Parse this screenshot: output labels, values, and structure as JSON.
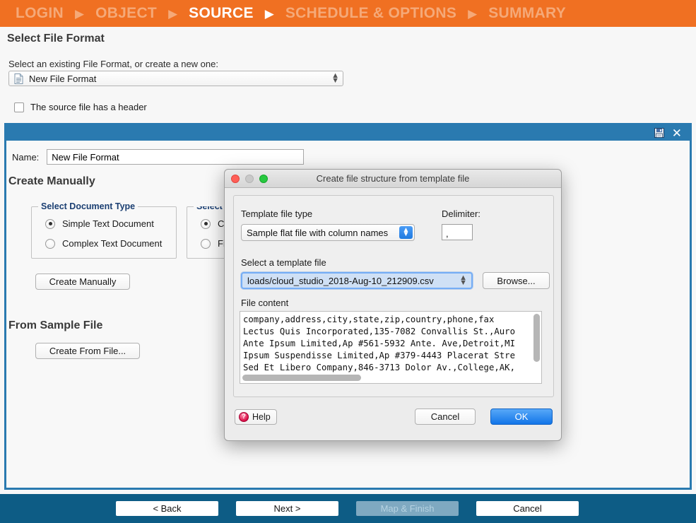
{
  "wizard": {
    "steps": [
      {
        "label": "LOGIN",
        "active": false
      },
      {
        "label": "OBJECT",
        "active": false
      },
      {
        "label": "SOURCE",
        "active": true
      },
      {
        "label": "SCHEDULE & OPTIONS",
        "active": false
      },
      {
        "label": "SUMMARY",
        "active": false
      }
    ],
    "arrow_glyph": "▶",
    "active_color": "#ffffff",
    "inactive_color": "#f5a978",
    "bar_color": "#f07022"
  },
  "page": {
    "title": "Select File Format",
    "format_prompt": "Select an existing File Format, or create a new one:",
    "format_selected": "New File Format",
    "header_checkbox_label": "The source file has a header",
    "header_checkbox_checked": false
  },
  "panel": {
    "titlebar_color": "#2a7ab0",
    "save_icon": "save-floppy-icon",
    "close_icon": "close-x-icon",
    "close_glyph": "✕",
    "name_label": "Name:",
    "name_value": "New File Format",
    "create_manually_title": "Create Manually",
    "document_type_group": {
      "legend": "Select Document Type",
      "options": [
        {
          "label": "Simple Text Document",
          "selected": true
        },
        {
          "label": "Complex Text Document",
          "selected": false
        }
      ]
    },
    "field_type_group": {
      "legend": "Select F",
      "options": [
        {
          "label": "Ch",
          "selected": true
        },
        {
          "label": "Fix",
          "selected": false
        }
      ]
    },
    "create_manually_button": "Create Manually",
    "from_sample_title": "From Sample File",
    "create_from_file_button": "Create From File..."
  },
  "dialog": {
    "title": "Create file structure from template file",
    "traffic_lights": [
      "close-button",
      "minimize-button",
      "zoom-button"
    ],
    "template_type_label": "Template file type",
    "template_type_value": "Sample flat file with column names",
    "delimiter_label": "Delimiter:",
    "delimiter_value": ",",
    "select_template_label": "Select a template file",
    "template_path_value": "loads/cloud_studio_2018-Aug-10_212909.csv",
    "browse_button": "Browse...",
    "file_content_label": "File content",
    "file_content": "company,address,city,state,zip,country,phone,fax\nLectus Quis Incorporated,135-7082 Convallis St.,Auro\nAnte Ipsum Limited,Ap #561-5932 Ante. Ave,Detroit,MI\nIpsum Suspendisse Limited,Ap #379-4443 Placerat Stre\nSed Et Libero Company,846-3713 Dolor Av.,College,AK,",
    "help_button": "Help",
    "help_glyph": "?",
    "cancel_button": "Cancel",
    "ok_button": "OK",
    "ok_color": "#1275e8"
  },
  "footer": {
    "bar_color": "#0d5c85",
    "buttons": [
      {
        "label": "< Back",
        "disabled": false
      },
      {
        "label": "Next >",
        "disabled": false
      },
      {
        "label": "Map & Finish",
        "disabled": true
      },
      {
        "label": "Cancel",
        "disabled": false
      }
    ]
  }
}
